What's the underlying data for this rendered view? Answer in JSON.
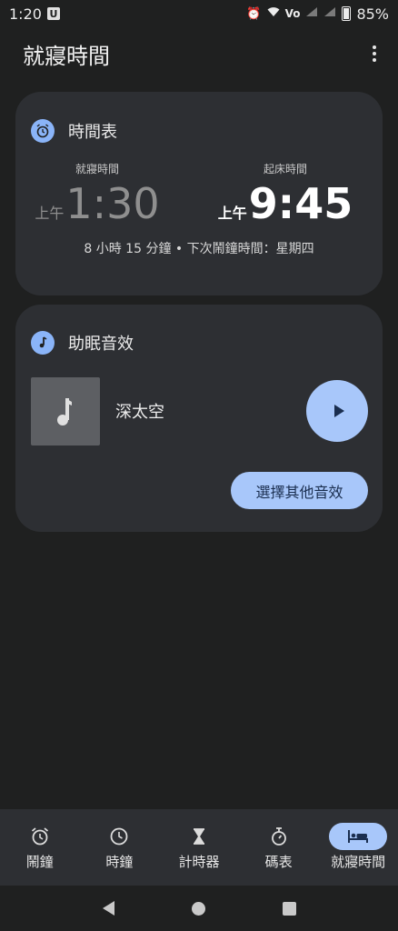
{
  "status_bar": {
    "time": "1:20",
    "app_badge": "U",
    "volte": "Vo",
    "battery": "85%"
  },
  "header": {
    "title": "就寢時間"
  },
  "schedule": {
    "title": "時間表",
    "bedtime": {
      "label": "就寢時間",
      "ampm": "上午",
      "time": "1:30"
    },
    "wake": {
      "label": "起床時間",
      "ampm": "上午",
      "time": "9:45"
    },
    "summary": "8 小時 15 分鐘 • 下次鬧鐘時間：星期四"
  },
  "sleep_sounds": {
    "title": "助眠音效",
    "track": "深太空",
    "choose_label": "選擇其他音效"
  },
  "bottom_nav": {
    "items": [
      {
        "label": "鬧鐘",
        "icon": "alarm-icon"
      },
      {
        "label": "時鐘",
        "icon": "clock-icon"
      },
      {
        "label": "計時器",
        "icon": "hourglass-icon"
      },
      {
        "label": "碼表",
        "icon": "stopwatch-icon"
      },
      {
        "label": "就寢時間",
        "icon": "bed-icon"
      }
    ],
    "active_index": 4
  },
  "colors": {
    "accent": "#a8c7fa",
    "card": "#2d2f33",
    "background": "#1f2020"
  }
}
